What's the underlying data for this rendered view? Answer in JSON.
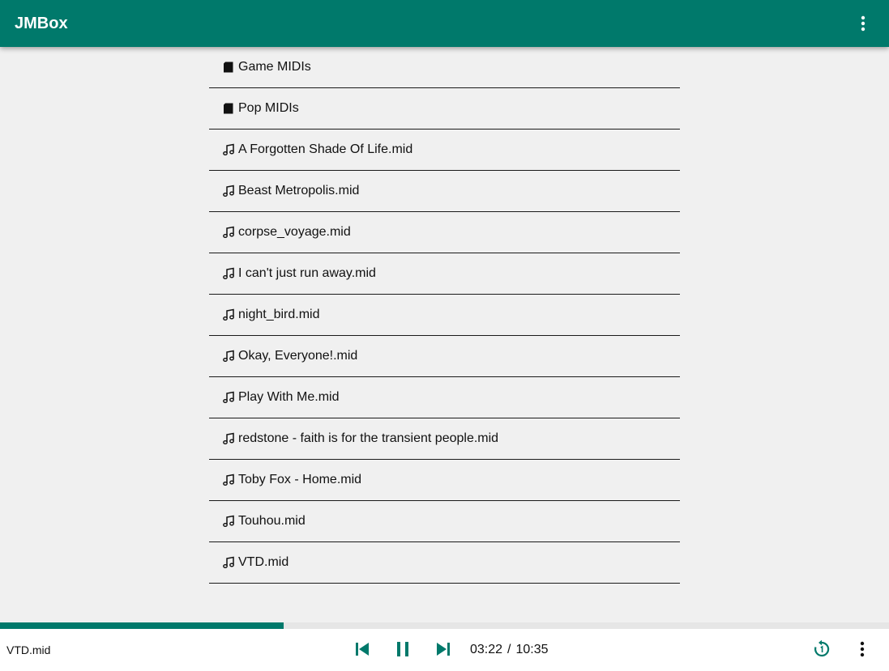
{
  "app": {
    "title": "JMBox",
    "accent": "#00796b"
  },
  "file_list": {
    "items": [
      {
        "type": "folder",
        "icon": "folder-icon",
        "label": "Game MIDIs"
      },
      {
        "type": "folder",
        "icon": "folder-icon",
        "label": "Pop MIDIs"
      },
      {
        "type": "file",
        "icon": "music-note-icon",
        "label": "A Forgotten Shade Of Life.mid"
      },
      {
        "type": "file",
        "icon": "music-note-icon",
        "label": "Beast Metropolis.mid"
      },
      {
        "type": "file",
        "icon": "music-note-icon",
        "label": "corpse_voyage.mid"
      },
      {
        "type": "file",
        "icon": "music-note-icon",
        "label": "I can't just run away.mid"
      },
      {
        "type": "file",
        "icon": "music-note-icon",
        "label": "night_bird.mid"
      },
      {
        "type": "file",
        "icon": "music-note-icon",
        "label": "Okay, Everyone!.mid"
      },
      {
        "type": "file",
        "icon": "music-note-icon",
        "label": "Play With Me.mid"
      },
      {
        "type": "file",
        "icon": "music-note-icon",
        "label": "redstone - faith is for the transient people.mid"
      },
      {
        "type": "file",
        "icon": "music-note-icon",
        "label": "Toby Fox - Home.mid"
      },
      {
        "type": "file",
        "icon": "music-note-icon",
        "label": "Touhou.mid"
      },
      {
        "type": "file",
        "icon": "music-note-icon",
        "label": "VTD.mid"
      }
    ]
  },
  "player": {
    "now_playing": "VTD.mid",
    "current_time": "03:22",
    "separator": "/",
    "total_time": "10:35",
    "progress": 0.319,
    "icons": {
      "previous": "skip-previous-icon",
      "pause": "pause-icon",
      "next": "skip-next-icon",
      "replay": "replay-one-icon",
      "menu": "more-vert-icon"
    }
  }
}
